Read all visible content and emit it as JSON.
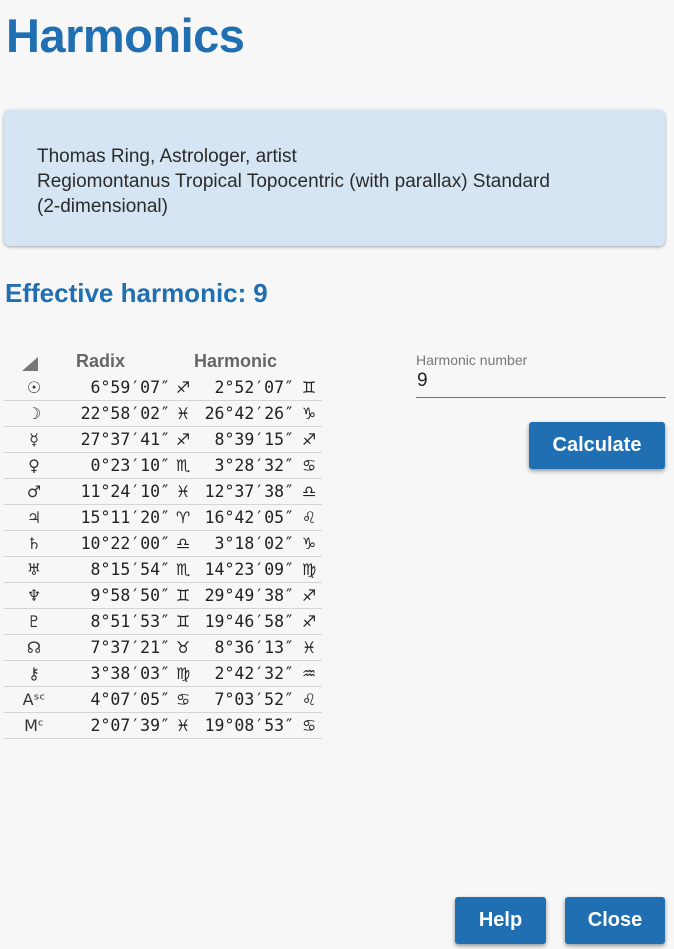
{
  "page_title": "Harmonics",
  "info": {
    "line1": "Thomas Ring, Astrologer, artist",
    "line2": "Regiomontanus Tropical Topocentric (with parallax) Standard",
    "line3": "(2-dimensional)"
  },
  "effective": {
    "label": "Effective harmonic:",
    "value": "9"
  },
  "table": {
    "col_radix": "Radix",
    "col_harmonic": "Harmonic",
    "rows": [
      {
        "glyph": "☉",
        "radix": "6°59′07″",
        "rsign": "♐",
        "harm": "2°52′07″",
        "hsign": "♊"
      },
      {
        "glyph": "☽",
        "radix": "22°58′02″",
        "rsign": "♓",
        "harm": "26°42′26″",
        "hsign": "♑"
      },
      {
        "glyph": "☿",
        "radix": "27°37′41″",
        "rsign": "♐",
        "harm": "8°39′15″",
        "hsign": "♐"
      },
      {
        "glyph": "♀",
        "radix": "0°23′10″",
        "rsign": "♏",
        "harm": "3°28′32″",
        "hsign": "♋"
      },
      {
        "glyph": "♂",
        "radix": "11°24′10″",
        "rsign": "♓",
        "harm": "12°37′38″",
        "hsign": "♎"
      },
      {
        "glyph": "♃",
        "radix": "15°11′20″",
        "rsign": "♈",
        "harm": "16°42′05″",
        "hsign": "♌"
      },
      {
        "glyph": "♄",
        "radix": "10°22′00″",
        "rsign": "♎",
        "harm": "3°18′02″",
        "hsign": "♑"
      },
      {
        "glyph": "♅",
        "radix": "8°15′54″",
        "rsign": "♏",
        "harm": "14°23′09″",
        "hsign": "♍"
      },
      {
        "glyph": "♆",
        "radix": "9°58′50″",
        "rsign": "♊",
        "harm": "29°49′38″",
        "hsign": "♐"
      },
      {
        "glyph": "♇",
        "radix": "8°51′53″",
        "rsign": "♊",
        "harm": "19°46′58″",
        "hsign": "♐"
      },
      {
        "glyph": "☊",
        "radix": "7°37′21″",
        "rsign": "♉",
        "harm": "8°36′13″",
        "hsign": "♓"
      },
      {
        "glyph": "⚷",
        "radix": "3°38′03″",
        "rsign": "♍",
        "harm": "2°42′32″",
        "hsign": "♒"
      },
      {
        "glyph": "Aˢᶜ",
        "radix": "4°07′05″",
        "rsign": "♋",
        "harm": "7°03′52″",
        "hsign": "♌"
      },
      {
        "glyph": "Mᶜ",
        "radix": "2°07′39″",
        "rsign": "♓",
        "harm": "19°08′53″",
        "hsign": "♋"
      }
    ]
  },
  "harmonic_field": {
    "label": "Harmonic number",
    "value": "9"
  },
  "buttons": {
    "calculate": "Calculate",
    "help": "Help",
    "close": "Close"
  },
  "colors": {
    "accent": "#1f6fb2",
    "card_bg": "#d6e5f3",
    "page_bg": "#f7f7f7"
  }
}
